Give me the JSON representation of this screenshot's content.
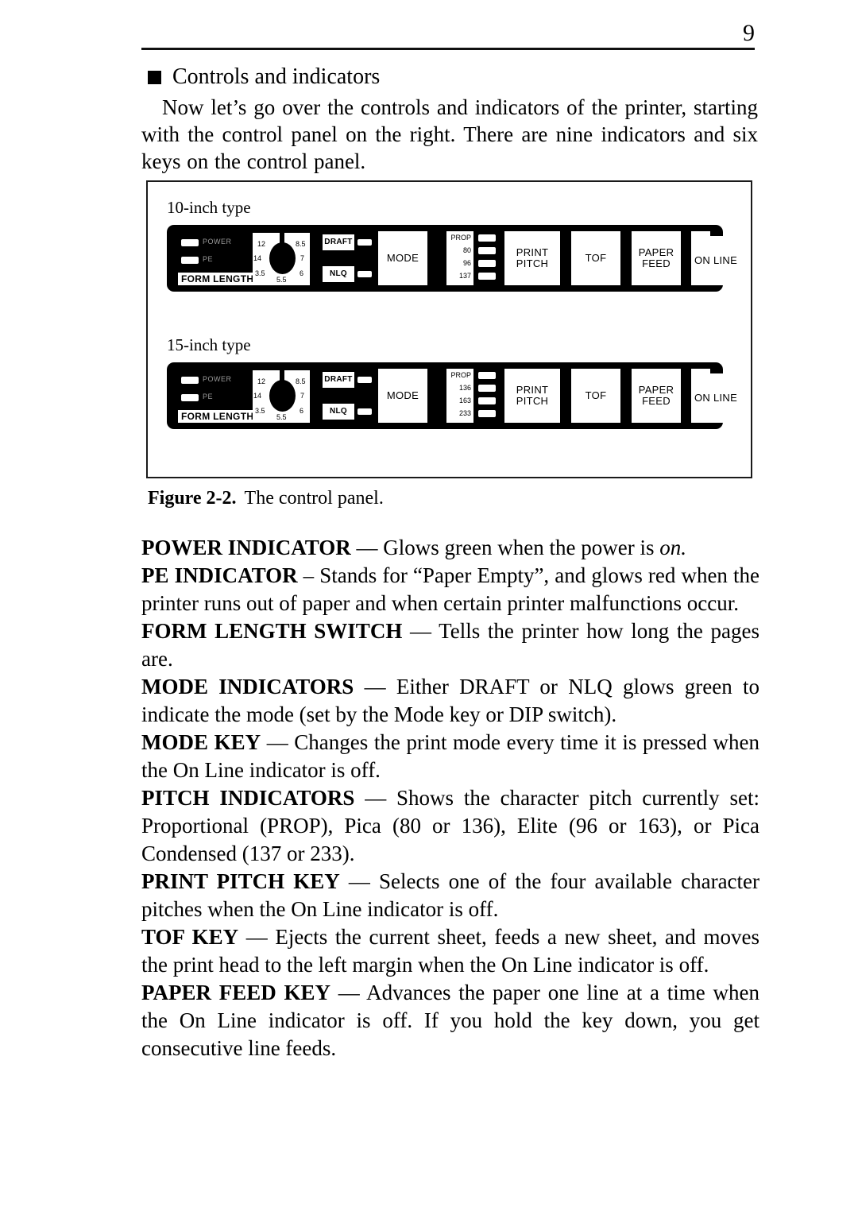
{
  "page": {
    "folio": "9"
  },
  "heading": {
    "bullet_icon": "filled-square-bullet",
    "title": "Controls and indicators"
  },
  "intro": {
    "text": "Now let’s go over the controls and indicators of the printer, starting with the control panel on the right. There are nine indicators and six keys on the control panel."
  },
  "figure": {
    "caption_label": "Figure 2-2.",
    "caption_text": "The control panel.",
    "panels": [
      {
        "caption": "10-inch type",
        "lamps": [
          {
            "name": "power-lamp",
            "label": "POWER"
          },
          {
            "name": "pe-lamp",
            "label": "PE"
          }
        ],
        "form_length_label": "FORM LENGTH",
        "dial_values": [
          "12",
          "8.5",
          "14",
          "7",
          "3.5",
          "6",
          "5.5"
        ],
        "mode_indicators": [
          "DRAFT",
          "NLQ"
        ],
        "pitch_indicators": [
          "PROP",
          "80",
          "96",
          "137"
        ],
        "keys": [
          "MODE",
          "PRINT PITCH",
          "TOF",
          "PAPER FEED",
          "ON LINE"
        ],
        "key_mode": "MODE",
        "key_pitch_line1": "PRINT",
        "key_pitch_line2": "PITCH",
        "key_tof": "TOF",
        "key_feed_line1": "PAPER",
        "key_feed_line2": "FEED",
        "key_online": "ON LINE"
      },
      {
        "caption": "15-inch type",
        "lamps": [
          {
            "name": "power-lamp",
            "label": "POWER"
          },
          {
            "name": "pe-lamp",
            "label": "PE"
          }
        ],
        "form_length_label": "FORM LENGTH",
        "dial_values": [
          "12",
          "8.5",
          "14",
          "7",
          "3.5",
          "6",
          "5.5"
        ],
        "mode_indicators": [
          "DRAFT",
          "NLQ"
        ],
        "pitch_indicators": [
          "PROP",
          "136",
          "163",
          "233"
        ],
        "keys": [
          "MODE",
          "PRINT PITCH",
          "TOF",
          "PAPER FEED",
          "ON LINE"
        ],
        "key_mode": "MODE",
        "key_pitch_line1": "PRINT",
        "key_pitch_line2": "PITCH",
        "key_tof": "TOF",
        "key_feed_line1": "PAPER",
        "key_feed_line2": "FEED",
        "key_online": "ON LINE"
      }
    ]
  },
  "entries": [
    {
      "term": "POWER INDICATOR",
      "dash": " — ",
      "body": "Glows green when the power is ",
      "italic_tail": "on.",
      "align": "j"
    },
    {
      "term": "PE INDICATOR",
      "dash": " – ",
      "body": "Stands for “Paper Empty”, and glows red when the printer runs out of paper and when certain printer malfunctions occur.",
      "italic_tail": "",
      "align": "j"
    },
    {
      "term": "FORM LENGTH SWITCH",
      "dash": " — ",
      "body": "Tells the printer how long the pages are.",
      "italic_tail": "",
      "align": "j"
    },
    {
      "term": "MODE INDICATORS",
      "dash": " — ",
      "body": "Either DRAFT or NLQ glows green to indicate the mode (set by the Mode key or DIP switch).",
      "italic_tail": "",
      "align": "j"
    },
    {
      "term": "MODE KEY",
      "dash": " — ",
      "body": "Changes the print mode every time it is pressed when the On Line indicator is off.",
      "italic_tail": "",
      "align": "j"
    },
    {
      "term": "PITCH INDICATORS",
      "dash": " — ",
      "body": "Shows the character pitch currently set: Proportional (PROP), Pica (80 or 136), Elite (96 or 163), or Pica Condensed (137 or 233).",
      "italic_tail": "",
      "align": "j"
    },
    {
      "term": "PRINT PITCH KEY",
      "dash": " — ",
      "body": "Selects one of the four available character pitches when the On Line indicator is off.",
      "italic_tail": "",
      "align": "j"
    },
    {
      "term": "TOF KEY",
      "dash": " — ",
      "body": "Ejects the current sheet, feeds a new sheet, and moves the print head to the left margin when the On Line indicator is off.",
      "italic_tail": "",
      "align": "j"
    },
    {
      "term": "PAPER FEED KEY",
      "dash": " — ",
      "body": "Advances the paper one line at a time when the On Line indicator is off. If you hold the key down, you get consecutive line feeds.",
      "italic_tail": "",
      "align": "j"
    }
  ]
}
